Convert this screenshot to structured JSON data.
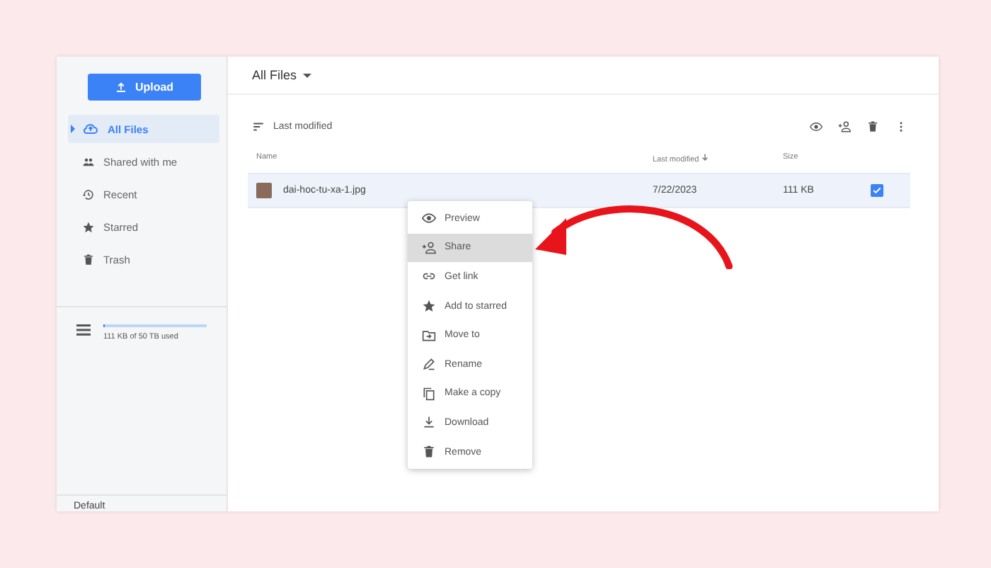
{
  "upload_button": {
    "label": "Upload"
  },
  "sidebar": {
    "items": [
      {
        "label": "All Files",
        "selected": true
      },
      {
        "label": "Shared with me",
        "selected": false
      },
      {
        "label": "Recent",
        "selected": false
      },
      {
        "label": "Starred",
        "selected": false
      },
      {
        "label": "Trash",
        "selected": false
      }
    ],
    "storage": {
      "text": "111 KB of 50 TB used",
      "level": 0.01
    },
    "footer": "Default"
  },
  "header": {
    "title": "All Files"
  },
  "toolbar": {
    "sort_label": "Last modified"
  },
  "table": {
    "columns": [
      "Name",
      "Last modified",
      "Size"
    ],
    "rows": [
      {
        "name": "dai-hoc-tu-xa-1.jpg",
        "modified": "7/22/2023",
        "size": "111 KB",
        "selected": true,
        "checked": true
      }
    ]
  },
  "context_menu": {
    "items": [
      {
        "label": "Preview",
        "selected": false
      },
      {
        "label": "Share",
        "selected": true
      },
      {
        "label": "Get link",
        "selected": false
      },
      {
        "label": "Add to starred",
        "selected": false
      },
      {
        "label": "Move to",
        "selected": false
      },
      {
        "label": "Rename",
        "selected": false
      },
      {
        "label": "Make a copy",
        "selected": false
      },
      {
        "label": "Download",
        "selected": false
      },
      {
        "label": "Remove",
        "selected": false
      }
    ]
  }
}
